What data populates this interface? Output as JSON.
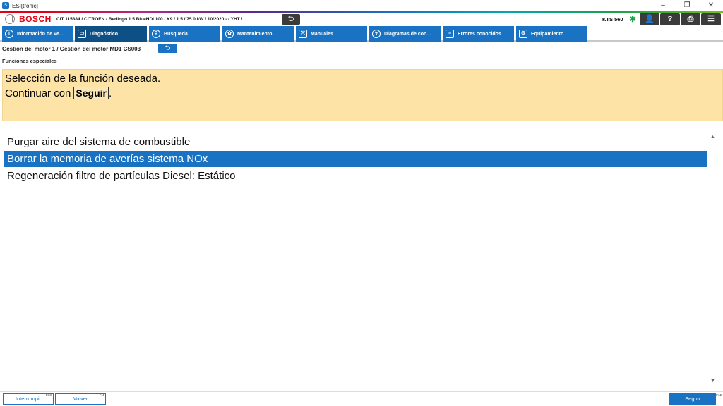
{
  "window": {
    "title": "ESI[tronic]",
    "icon": "esi-app-icon",
    "controls": {
      "minimize": "–",
      "restore": "❐",
      "close": "✕"
    }
  },
  "header": {
    "brand": "BOSCH",
    "vehicle": "CIT 115384 / CITROEN / Berlingo 1.5 BlueHDi 100 / K9 / 1.5 / 75.0 kW / 10/2020 - / YHT /",
    "device": "KTS 560",
    "back_glyph": "⮌",
    "bluetooth_glyph": "✱",
    "buttons": [
      {
        "name": "user-button",
        "glyph": "👤"
      },
      {
        "name": "help-button",
        "glyph": "?"
      },
      {
        "name": "print-button",
        "glyph": "⎙"
      },
      {
        "name": "menu-button",
        "glyph": "☰"
      }
    ]
  },
  "tabs": [
    {
      "label": "Información de ve...",
      "icon": "info-icon",
      "glyph": "i",
      "active": false
    },
    {
      "label": "Diagnóstico",
      "icon": "diagnostic-icon",
      "glyph": "▭",
      "active": true
    },
    {
      "label": "Búsqueda",
      "icon": "search-icon",
      "glyph": "⚲",
      "active": false
    },
    {
      "label": "Mantenimiento",
      "icon": "maintenance-icon",
      "glyph": "✿",
      "active": false
    },
    {
      "label": "Manuales",
      "icon": "manuals-icon",
      "glyph": "⤧",
      "active": false
    },
    {
      "label": "Diagramas de con...",
      "icon": "diagram-icon",
      "glyph": "ϟ",
      "active": false
    },
    {
      "label": "Errores conocidos",
      "icon": "known-errors-icon",
      "glyph": "≡",
      "active": false
    },
    {
      "label": "Equipamiento",
      "icon": "equipment-icon",
      "glyph": "⚙",
      "active": false
    }
  ],
  "breadcrumb": {
    "text": "Gestión del motor 1 / Gestión del motor MD1 CS003",
    "back_glyph": "⮌"
  },
  "subtitle": "Funciones especiales",
  "instruction": {
    "line1": "Selección de la función deseada.",
    "line2_prefix": "Continuar con",
    "line2_key": "Seguir",
    "line2_suffix": "."
  },
  "functions": {
    "items": [
      {
        "label": "Purgar aire del sistema de combustible",
        "selected": false
      },
      {
        "label": "Borrar la memoria de averías sistema NOx",
        "selected": true
      },
      {
        "label": "Regeneración filtro de partículas Diesel: Estático",
        "selected": false
      }
    ]
  },
  "scrollbar": {
    "up": "▲",
    "down": "▼"
  },
  "footer": {
    "cancel": {
      "label": "Interrumpir",
      "key": "ESC"
    },
    "back": {
      "label": "Volver",
      "key": "F11"
    },
    "next": {
      "label": "Seguir",
      "key": "F12"
    }
  },
  "colors": {
    "accent": "#1a73c2",
    "active_tab": "#0e4f86",
    "instruction_bg": "#fde3a6",
    "brand_red": "#e20015"
  }
}
